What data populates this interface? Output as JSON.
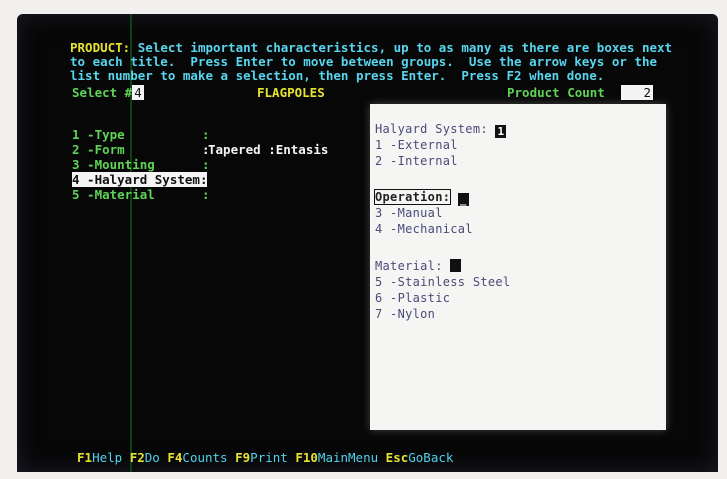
{
  "instructions": {
    "line1_prefix": "PRODUCT:",
    "line1_rest": " Select important characteristics, up to as many as there are boxes next",
    "line2": "to each title.  Press Enter to move between groups.  Use the arrow keys or the",
    "line3": "list number to make a selection, then press Enter.  Press F2 when done."
  },
  "header": {
    "select_label": "Select #",
    "select_value": "4",
    "title": "FLAGPOLES",
    "product_count_label": "Product Count",
    "product_count_value": "2"
  },
  "characteristics": [
    {
      "label": "1 -Type",
      "colon": ":",
      "value": ""
    },
    {
      "label": "2 -Form",
      "colon": ":",
      "value": "Tapered :Entasis"
    },
    {
      "label": "3 -Mounting",
      "colon": ":",
      "value": ""
    },
    {
      "label": "4 -Halyard System",
      "colon": ":",
      "value": ""
    },
    {
      "label": "5 -Material",
      "colon": ":",
      "value": ""
    }
  ],
  "panel": {
    "groups": [
      {
        "title": "Halyard System:",
        "box": "1",
        "items": [
          "1 -External",
          "2 -Internal"
        ]
      },
      {
        "title": "Operation:",
        "box": "_",
        "items": [
          "3 -Manual",
          "4 -Mechanical"
        ]
      },
      {
        "title": "Material:",
        "box": "",
        "items": [
          "5 -Stainless Steel",
          "6 -Plastic",
          "7 -Nylon"
        ]
      }
    ]
  },
  "function_keys": [
    {
      "key": "F1",
      "desc": "Help"
    },
    {
      "key": "F2",
      "desc": "Do"
    },
    {
      "key": "F4",
      "desc": "Counts"
    },
    {
      "key": "F9",
      "desc": "Print"
    },
    {
      "key": "F10",
      "desc": "MainMenu"
    },
    {
      "key": "Esc",
      "desc": "GoBack"
    }
  ],
  "colors": {
    "instruction_text": "#57d6ee",
    "highlight_text": "#e6e232",
    "header_title": "#e6e232",
    "product_count": "#5fd357",
    "panel_bg": "#f5f5f3"
  }
}
